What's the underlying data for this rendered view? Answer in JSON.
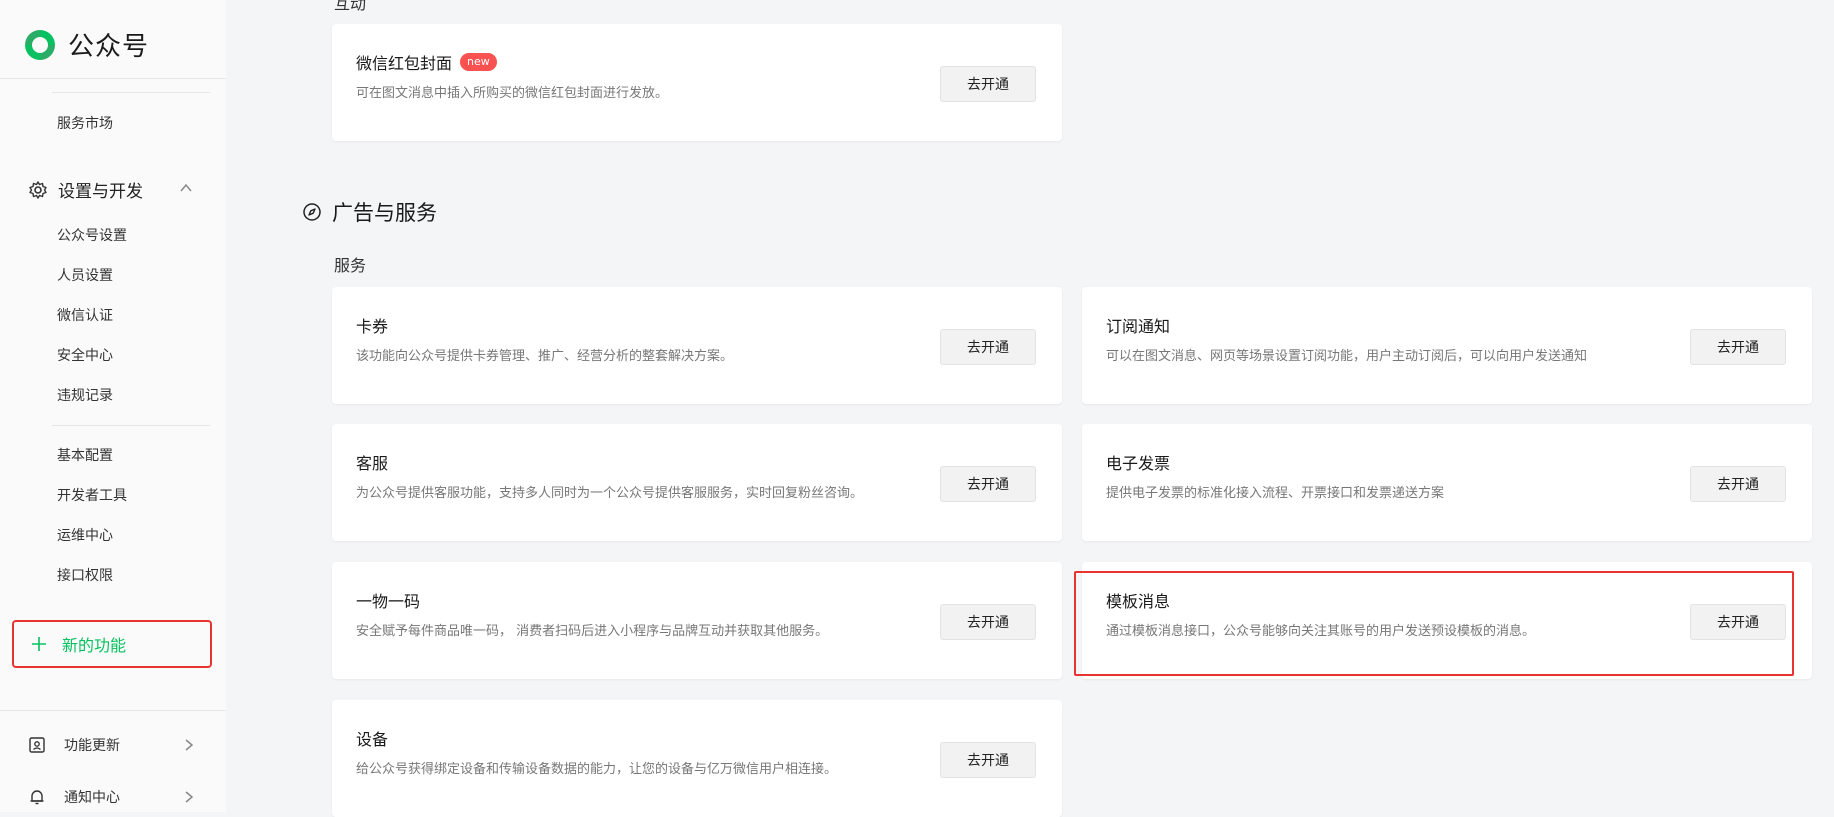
{
  "app": {
    "name": "公众号",
    "brand_color": "#07c160",
    "highlight_color": "#e8332f"
  },
  "sidebar": {
    "top_item": "服务市场",
    "group": {
      "title": "设置与开发",
      "icon": "gear-icon",
      "expanded": true,
      "items_a": [
        "公众号设置",
        "人员设置",
        "微信认证",
        "安全中心",
        "违规记录"
      ],
      "items_b": [
        "基本配置",
        "开发者工具",
        "运维中心",
        "接口权限"
      ]
    },
    "new_function": "新的功能",
    "bottom": [
      {
        "label": "功能更新",
        "icon": "update-icon"
      },
      {
        "label": "通知中心",
        "icon": "bell-icon"
      }
    ]
  },
  "main": {
    "partial_top_label": "互动",
    "red_packet_card": {
      "title": "微信红包封面",
      "badge": "new",
      "desc": "可在图文消息中插入所购买的微信红包封面进行发放。",
      "button": "去开通"
    },
    "section": {
      "title": "广告与服务",
      "icon": "compass-icon",
      "subsection": "服务",
      "cards": [
        {
          "title": "卡券",
          "desc": "该功能向公众号提供卡券管理、推广、经营分析的整套解决方案。",
          "button": "去开通"
        },
        {
          "title": "订阅通知",
          "desc": "可以在图文消息、网页等场景设置订阅功能，用户主动订阅后，可以向用户发送通知",
          "button": "去开通"
        },
        {
          "title": "客服",
          "desc": "为公众号提供客服功能，支持多人同时为一个公众号提供客服服务，实时回复粉丝咨询。",
          "button": "去开通"
        },
        {
          "title": "电子发票",
          "desc": "提供电子发票的标准化接入流程、开票接口和发票递送方案",
          "button": "去开通"
        },
        {
          "title": "一物一码",
          "desc": "安全赋予每件商品唯一码， 消费者扫码后进入小程序与品牌互动并获取其他服务。",
          "button": "去开通"
        },
        {
          "title": "模板消息",
          "desc": "通过模板消息接口，公众号能够向关注其账号的用户发送预设模板的消息。",
          "button": "去开通"
        },
        {
          "title": "设备",
          "desc": "给公众号获得绑定设备和传输设备数据的能力，让您的设备与亿万微信用户相连接。",
          "button": "去开通"
        }
      ]
    }
  }
}
